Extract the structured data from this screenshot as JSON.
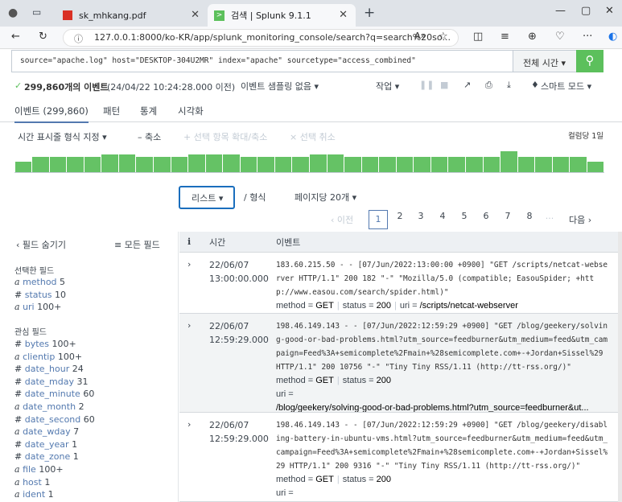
{
  "browser": {
    "tabs": [
      {
        "label": "sk_mhkang.pdf"
      },
      {
        "label": "검색 | Splunk 9.1.1"
      }
    ],
    "url": "127.0.0.1:8000/ko-KR/app/splunk_monitoring_console/search?q=search%20so..."
  },
  "search": {
    "query": "source=\"apache.log\" host=\"DESKTOP-304U2MR\" index=\"apache\" sourcetype=\"access_combined\"",
    "time_picker": "전체 시간 ▾"
  },
  "status": {
    "count": "299,860개의 이벤트",
    "since": "(24/04/22 10:24:28.000 이전)",
    "sampling": "이벤트 샘플링 없음 ▾",
    "job": "작업 ▾",
    "mode": "스마트 모드 ▾"
  },
  "tabs": {
    "events": "이벤트 (299,860)",
    "patterns": "패턴",
    "stats": "통계",
    "viz": "시각화"
  },
  "timeline": {
    "format": "시간 표시줄 형식 지정 ▾",
    "zoom_out": "– 축소",
    "zoom_sel": "+ 선택 항목 확대/축소",
    "deselect": "× 선택 취소",
    "per_col": "컬럼당 1일"
  },
  "chart_data": {
    "type": "bar",
    "values": [
      0.4,
      0.6,
      0.6,
      0.6,
      0.6,
      0.7,
      0.7,
      0.6,
      0.6,
      0.6,
      0.7,
      0.7,
      0.7,
      0.6,
      0.6,
      0.6,
      0.6,
      0.7,
      0.7,
      0.6,
      0.6,
      0.6,
      0.6,
      0.6,
      0.6,
      0.6,
      0.6,
      0.6,
      0.8,
      0.6,
      0.6,
      0.6,
      0.6,
      0.4
    ]
  },
  "pager": {
    "list": "리스트 ▾",
    "format": "/ 형식",
    "perpage": "페이지당 20개 ▾",
    "prev": "‹ 이전",
    "pages": [
      "1",
      "2",
      "3",
      "4",
      "5",
      "6",
      "7",
      "8",
      "..."
    ],
    "next": "다음 ›"
  },
  "fields": {
    "hide": "‹ 필드 숨기기",
    "all": "≡ 모든 필드",
    "selected_title": "선택한 필드",
    "selected": [
      {
        "t": "a",
        "n": "method",
        "c": "5"
      },
      {
        "t": "#",
        "n": "status",
        "c": "10"
      },
      {
        "t": "a",
        "n": "uri",
        "c": "100+"
      }
    ],
    "interesting_title": "관심 필드",
    "interesting": [
      {
        "t": "#",
        "n": "bytes",
        "c": "100+"
      },
      {
        "t": "a",
        "n": "clientip",
        "c": "100+"
      },
      {
        "t": "#",
        "n": "date_hour",
        "c": "24"
      },
      {
        "t": "#",
        "n": "date_mday",
        "c": "31"
      },
      {
        "t": "#",
        "n": "date_minute",
        "c": "60"
      },
      {
        "t": "a",
        "n": "date_month",
        "c": "2"
      },
      {
        "t": "#",
        "n": "date_second",
        "c": "60"
      },
      {
        "t": "a",
        "n": "date_wday",
        "c": "7"
      },
      {
        "t": "#",
        "n": "date_year",
        "c": "1"
      },
      {
        "t": "#",
        "n": "date_zone",
        "c": "1"
      },
      {
        "t": "a",
        "n": "file",
        "c": "100+"
      },
      {
        "t": "a",
        "n": "host",
        "c": "1"
      },
      {
        "t": "a",
        "n": "ident",
        "c": "1"
      }
    ]
  },
  "events_header": {
    "i": "i",
    "time": "시간",
    "event": "이벤트"
  },
  "events": [
    {
      "date": "22/06/07",
      "time": "13:00:00.000",
      "raw": "183.60.215.50 - - [07/Jun/2022:13:00:00 +0900] \"GET /scripts/netcat-webserver HTTP/1.1\" 200 182 \"-\" \"Mozilla/5.0 (compatible; EasouSpider; +http://www.easou.com/search/spider.html)\"",
      "method": "GET",
      "status": "200",
      "uri": "/scripts/netcat-webserver"
    },
    {
      "date": "22/06/07",
      "time": "12:59:29.000",
      "raw": "198.46.149.143 - - [07/Jun/2022:12:59:29 +0900] \"GET /blog/geekery/solving-good-or-bad-problems.html?utm_source=feedburner&utm_medium=feed&utm_campaign=Feed%3A+semicomplete%2Fmain+%28semicomplete.com+-+Jordan+Sissel%29 HTTP/1.1\" 200 10756 \"-\" \"Tiny Tiny RSS/1.11 (http://tt-rss.org/)\"",
      "method": "GET",
      "status": "200",
      "uri": "/blog/geekery/solving-good-or-bad-problems.html?utm_source=feedburner&ut..."
    },
    {
      "date": "22/06/07",
      "time": "12:59:29.000",
      "raw": "198.46.149.143 - - [07/Jun/2022:12:59:29 +0900] \"GET /blog/geekery/disabling-battery-in-ubuntu-vms.html?utm_source=feedburner&utm_medium=feed&utm_campaign=Feed%3A+semicomplete%2Fmain+%28semicomplete.com+-+Jordan+Sissel%29 HTTP/1.1\" 200 9316 \"-\" \"Tiny Tiny RSS/1.11 (http://tt-rss.org/)\"",
      "method": "GET",
      "status": "200",
      "uri": "/blog/geekery/disabling-battery-in-ubuntu-vms.html?utm_source=feedburner&ut..."
    }
  ]
}
